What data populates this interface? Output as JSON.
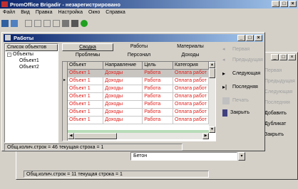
{
  "app": {
    "title": "PromOffice Brigadir - незарегистрировано"
  },
  "menu": [
    "Файл",
    "Вид",
    "Правка",
    "Настройка",
    "Окно",
    "Справка"
  ],
  "inner": {
    "title": "Работы",
    "tree_header": "Список объектов",
    "tree": {
      "root": "Объекты",
      "children": [
        "Объект1",
        "Объект2"
      ]
    },
    "tabs_row1": [
      "Сводка",
      "Работы",
      "Материалы"
    ],
    "tabs_row2": [
      "Проблемы",
      "Персонал",
      "Доходы"
    ],
    "columns": [
      "Объект",
      "Направление",
      "Цель",
      "Категория"
    ],
    "rows": [
      [
        "Объект 1",
        "Доходы",
        "Работа",
        "Оплата работ"
      ],
      [
        "Объект 1",
        "Доходы",
        "Работа",
        "Оплата работ"
      ],
      [
        "Объект 1",
        "Доходы",
        "Работа",
        "Оплата работ"
      ],
      [
        "Объект 1",
        "Доходы",
        "Работа",
        "Оплата работ"
      ],
      [
        "Объект 1",
        "Доходы",
        "Работа",
        "Оплата работ"
      ],
      [
        "Объект 1",
        "Доходы",
        "Работа",
        "Оплата работ"
      ],
      [
        "Объект 1",
        "Доходы",
        "Работа",
        "Оплата работ"
      ]
    ],
    "status": "Общ.колич.строк = 46 текущая строка = 1",
    "side_buttons": [
      "Первая",
      "Предыдущая",
      "Следующая",
      "Последняя",
      "Печать",
      "Закрыть"
    ]
  },
  "back": {
    "buttons": [
      "Первая",
      "Предыдущая",
      "Следующая",
      "Последняя",
      "Добавить",
      "Дубликат",
      "Закрыть"
    ],
    "field_value": "Бетон",
    "status": "Общ.колич.строк = 11 текущая строка = 1"
  },
  "colors": {
    "title_start": "#0a246a",
    "title_end": "#a6caf0",
    "data_text": "#e0201c"
  }
}
